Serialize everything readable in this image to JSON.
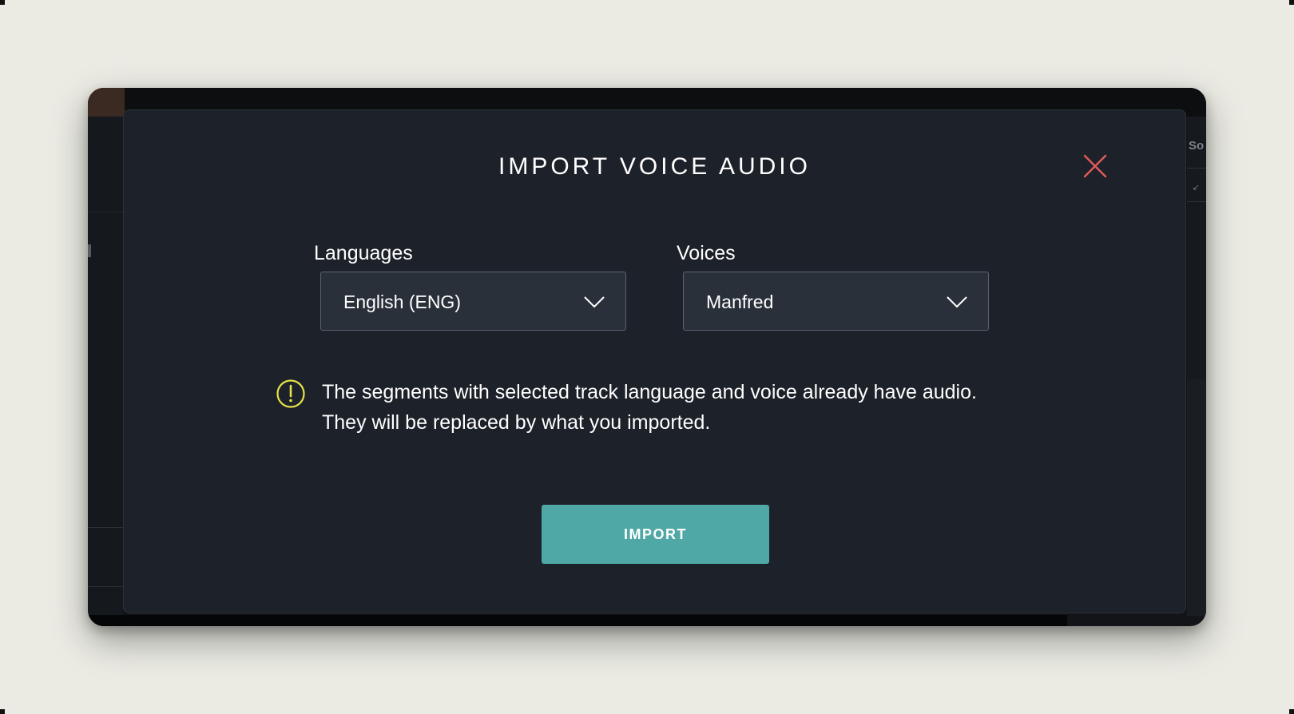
{
  "modal": {
    "title": "IMPORT VOICE AUDIO",
    "close_icon": "close-icon",
    "languages": {
      "label": "Languages",
      "selected": "English (ENG)"
    },
    "voices": {
      "label": "Voices",
      "selected": "Manfred"
    },
    "warning": {
      "icon": "exclamation-circle-icon",
      "text": "The segments with selected track language and voice already have audio. They will be replaced by what you imported."
    },
    "import_button": "IMPORT"
  },
  "background": {
    "right_panel_text": "So"
  },
  "colors": {
    "page_background": "#ebebe4",
    "modal_background": "#1d2129",
    "select_background": "#2a303a",
    "accent_button": "#4fa8a6",
    "close_icon": "#e05a5a",
    "warning_icon": "#e6e24a"
  }
}
